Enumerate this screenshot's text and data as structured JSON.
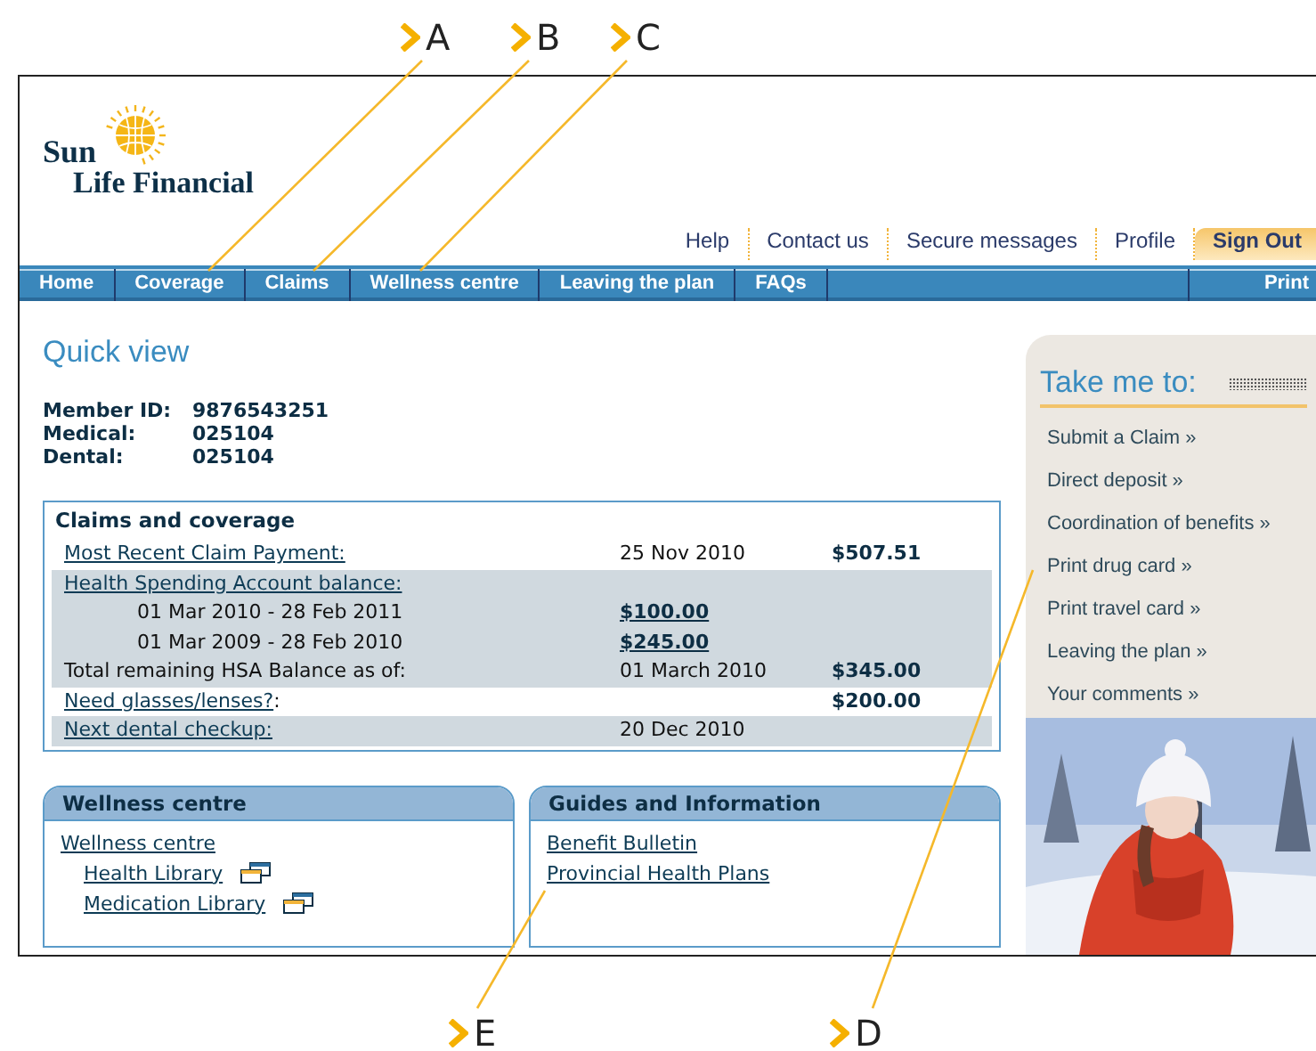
{
  "callouts_top": [
    {
      "label": "A"
    },
    {
      "label": "B"
    },
    {
      "label": "C"
    }
  ],
  "callouts_bottom": [
    {
      "label": "E"
    },
    {
      "label": "D"
    }
  ],
  "header": {
    "logo_lines": [
      "Sun",
      "Life Financial"
    ],
    "utility_links": [
      "Help",
      "Contact us",
      "Secure messages",
      "Profile"
    ],
    "sign_out": "Sign Out"
  },
  "nav": {
    "items": [
      "Home",
      "Coverage",
      "Claims",
      "Wellness centre",
      "Leaving the plan",
      "FAQs"
    ],
    "print": "Print"
  },
  "quick_view": {
    "title": "Quick view",
    "member_info": [
      {
        "label": "Member ID:",
        "value": "9876543251"
      },
      {
        "label": "Medical:",
        "value": "025104"
      },
      {
        "label": "Dental:",
        "value": "025104"
      }
    ]
  },
  "claims": {
    "title": "Claims and coverage",
    "rows": [
      {
        "kind": "link",
        "label": "Most Recent Claim Payment:",
        "mid": "25 Nov 2010",
        "amount": "$507.51",
        "shaded": false
      },
      {
        "kind": "link",
        "label": "Health Spending Account balance:",
        "shaded": true
      },
      {
        "kind": "period",
        "label": "01 Mar 2010 - 28 Feb 2011",
        "mid": "$100.00",
        "shaded": true
      },
      {
        "kind": "period",
        "label": "01 Mar 2009 - 28 Feb 2010",
        "mid": "$245.00",
        "shaded": true
      },
      {
        "kind": "total",
        "label": "Total remaining HSA Balance as of:",
        "mid": "01 March 2010",
        "amount": "$345.00",
        "shaded": true
      },
      {
        "kind": "link",
        "label": "Need glasses/lenses?",
        "suffix": ":",
        "amount": "$200.00",
        "shaded": false
      },
      {
        "kind": "link",
        "label": "Next dental checkup:",
        "mid": "20 Dec 2010",
        "shaded": true
      }
    ]
  },
  "panels": [
    {
      "title": "Wellness centre",
      "links": [
        {
          "kind": "link",
          "label": "Wellness centre"
        },
        {
          "kind": "popup",
          "label": "Health Library"
        },
        {
          "kind": "popup",
          "label": "Medication Library"
        }
      ]
    },
    {
      "title": "Guides and Information",
      "links": [
        {
          "kind": "link",
          "label": "Benefit Bulletin"
        },
        {
          "kind": "link",
          "label": "Provincial Health Plans"
        }
      ]
    }
  ],
  "sidebar": {
    "title": "Take me to:",
    "links": [
      "Submit a Claim »",
      "Direct deposit »",
      "Coordination of benefits »",
      "Print drug card »",
      "Print travel card »",
      "Leaving the plan »",
      "Your comments »"
    ]
  }
}
